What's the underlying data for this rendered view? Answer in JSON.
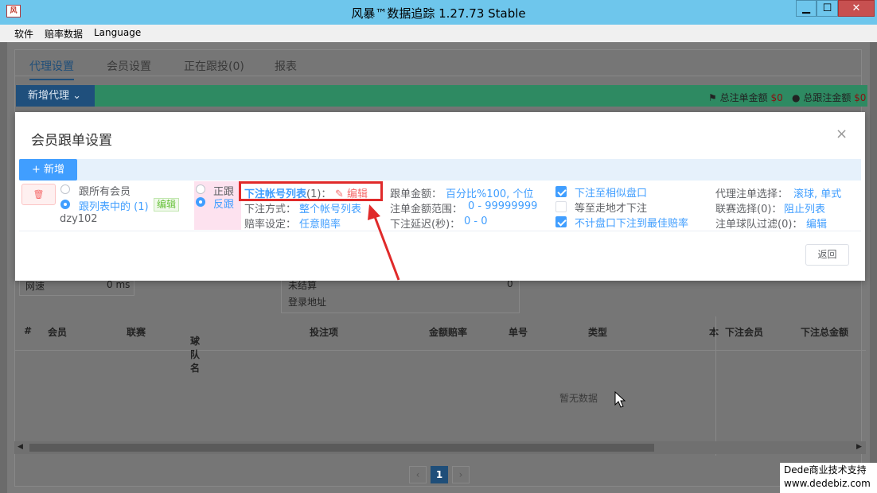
{
  "window": {
    "title": "风暴™数据追踪 1.27.73 Stable",
    "min": "▁",
    "max": "☐",
    "close": "✕"
  },
  "menu": [
    "软件",
    "赔率数据",
    "Language"
  ],
  "tabs": [
    "代理设置",
    "会员设置",
    "正在跟投(0)",
    "报表"
  ],
  "toolbar": {
    "add_agent": "新增代理",
    "stat1_label": "总注单金额",
    "stat1_value": "$0",
    "stat2_label": "总跟注金额",
    "stat2_value": "$0"
  },
  "bg": {
    "net_label": "网速",
    "net_value": "0 ms",
    "unsettled": "未结算",
    "unsettled_value": "0",
    "login_addr": "登录地址"
  },
  "table": {
    "headers": [
      "#",
      "会员",
      "联赛",
      "球队名",
      "投注项",
      "金额赔率",
      "单号",
      "类型",
      "本",
      "下注会员",
      "下注总金额"
    ],
    "empty": "暂无数据"
  },
  "pagination": {
    "prev": "‹",
    "current": "1",
    "next": "›"
  },
  "modal": {
    "title": "会员跟单设置",
    "close": "×",
    "add_button": "新增",
    "delete_icon": "🗑",
    "radio_all": "跟所有会员",
    "radio_list": "跟列表中的 (1)",
    "edit_tag": "编辑",
    "member": "dzy102",
    "follow_pos": "正跟",
    "follow_neg": "反跟",
    "bet_account_label": "下注帐号列表",
    "bet_account_count": "(1)：",
    "bet_account_edit": "编辑",
    "bet_method_label": "下注方式：",
    "bet_method_value": "整个帐号列表",
    "odds_label": "赔率设定：",
    "odds_value": "任意赔率",
    "amount_label": "跟单金额：",
    "amount_value": "百分比%100, 个位",
    "range_label": "注单金额范围：",
    "range_value": "0 - 99999999",
    "delay_label": "下注延迟(秒)：",
    "delay_value": "0 - 0",
    "opt1": "下注至相似盘口",
    "opt2": "等至走地才下注",
    "opt3": "不计盘口下注到最佳赔率",
    "agent_label": "代理注单选择：",
    "agent_value": "滚球, 单式",
    "league_label": "联赛选择(0)：",
    "league_value": "阻止列表",
    "team_label": "注单球队过滤(0)：",
    "team_value": "编辑",
    "back": "返回"
  },
  "watermark": {
    "line1": "Dede商业技术支持",
    "line2": "www.dedebiz.com"
  }
}
